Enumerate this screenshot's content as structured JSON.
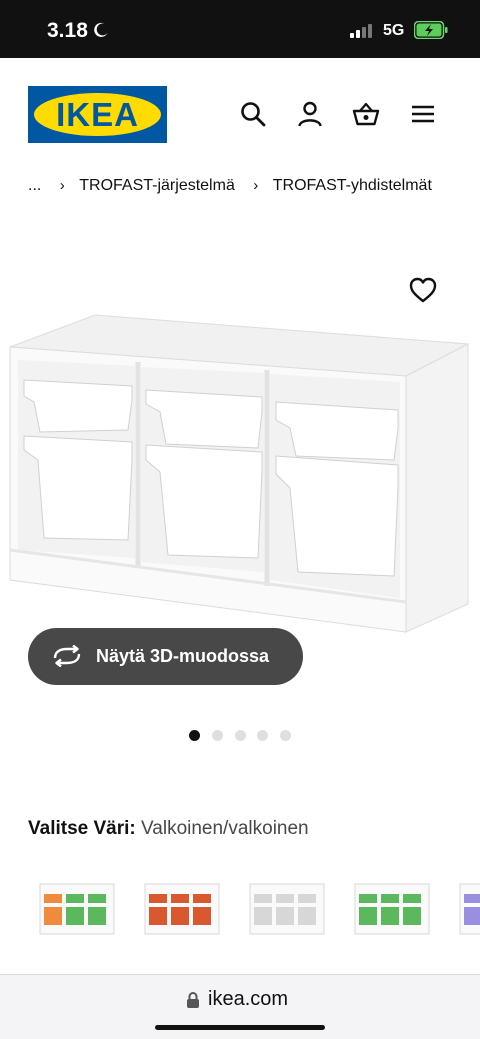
{
  "status_bar": {
    "time": "3.18",
    "network": "5G"
  },
  "header": {
    "logo_text": "IKEA"
  },
  "breadcrumb": {
    "ellipsis": "...",
    "items": [
      "TROFAST-järjestelmä",
      "TROFAST-yhdistelmät"
    ]
  },
  "product": {
    "view_3d_label": "Näytä 3D-muodossa",
    "carousel": {
      "total": 5,
      "active_index": 0
    },
    "color_label": "Valitse Väri:",
    "color_value": "Valkoinen/valkoinen"
  },
  "swatches": [
    {
      "bin_colors": [
        "#f08a3c",
        "#5cb85c",
        "#5cb85c"
      ]
    },
    {
      "bin_colors": [
        "#d9582f",
        "#d9582f",
        "#d9582f"
      ]
    },
    {
      "bin_colors": [
        "#d7d7d7",
        "#d7d7d7",
        "#d7d7d7"
      ]
    },
    {
      "bin_colors": [
        "#5cb85c",
        "#5cb85c",
        "#5cb85c"
      ]
    },
    {
      "bin_colors": [
        "#9a8ee0"
      ]
    }
  ],
  "browser": {
    "url": "ikea.com"
  },
  "colors": {
    "ikea_blue": "#0058a3",
    "ikea_yellow": "#ffdb00",
    "button_dark": "#484848"
  }
}
